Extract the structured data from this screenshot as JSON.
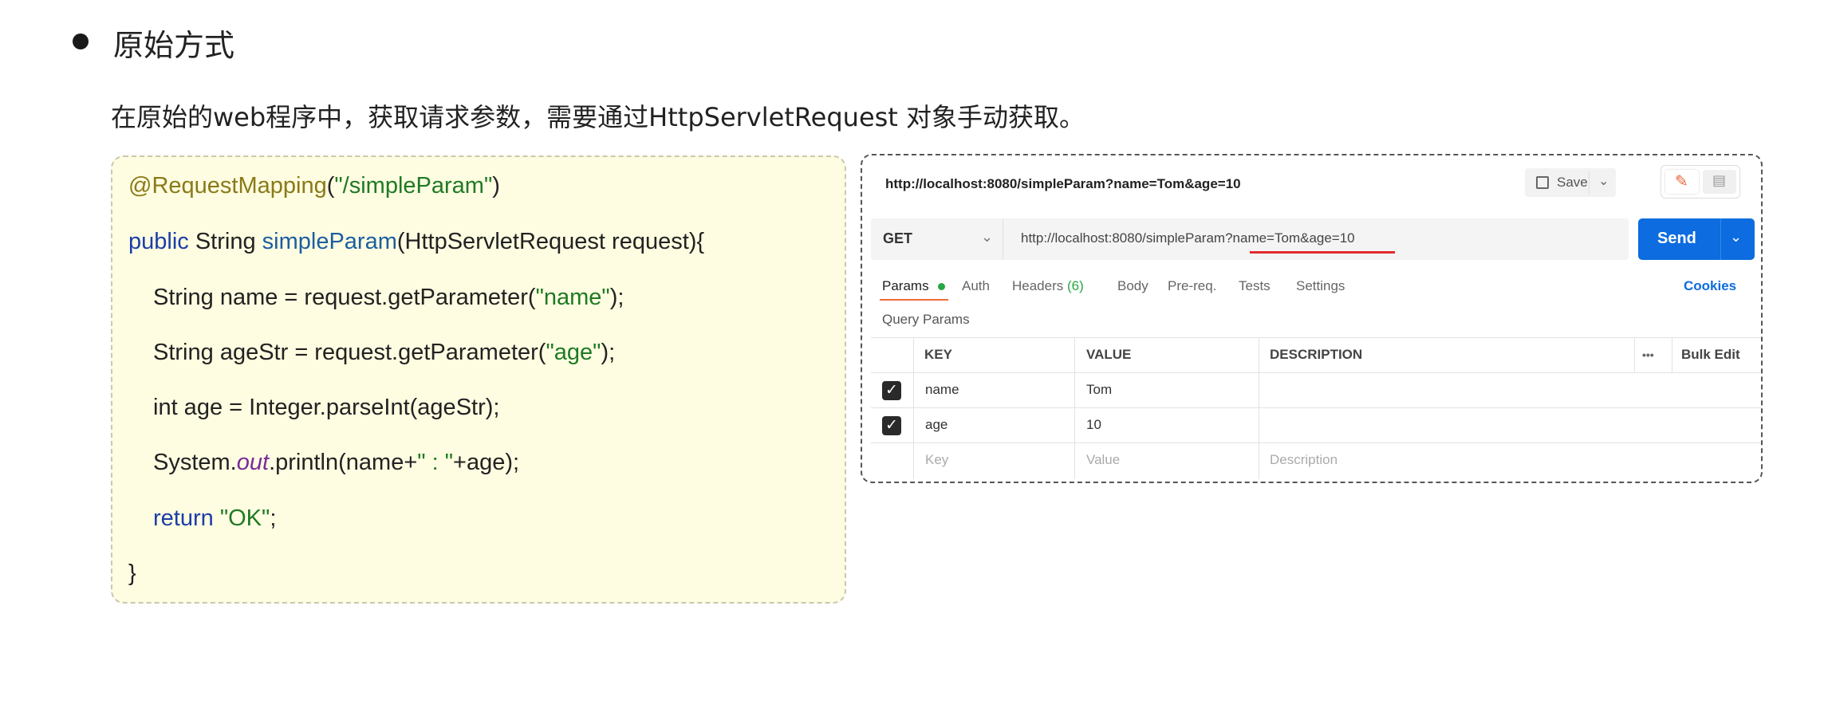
{
  "section": {
    "heading": "原始方式",
    "description": "在原始的web程序中，获取请求参数，需要通过HttpServletRequest 对象手动获取。"
  },
  "code": {
    "l1": {
      "annotation": "@RequestMapping",
      "open": "(",
      "path": "\"/simpleParam\"",
      "close": ")"
    },
    "l2": {
      "public": "public",
      "type": " String ",
      "method": "simpleParam",
      "params": "(HttpServletRequest request){"
    },
    "l3": {
      "a": "String name = request.getParameter(",
      "s": "\"name\"",
      "b": ");"
    },
    "l4": {
      "a": "String ageStr = request.getParameter(",
      "s": "\"age\"",
      "b": ");"
    },
    "l5": "int age = Integer.parseInt(ageStr);",
    "l6": {
      "a": "System.",
      "field": "out",
      "b": ".println(name+",
      "s": "\" : \"",
      "c": "+age);"
    },
    "l7": {
      "kw": "return",
      "s": " \"OK\"",
      "b": ";"
    },
    "l8": "}"
  },
  "postman": {
    "top_url": "http://localhost:8080/simpleParam?name=Tom&age=10",
    "save_label": "Save",
    "save_chevron": "⌄",
    "edit_icon_glyph": "✎",
    "comment_icon_glyph": "▤",
    "method": "GET",
    "method_chevron": "⌄",
    "url": "http://localhost:8080/simpleParam?name=Tom&age=10",
    "send_label": "Send",
    "send_chevron": "⌄",
    "tabs": {
      "params": "Params",
      "auth": "Auth",
      "headers": "Headers",
      "headers_count": "(6)",
      "body": "Body",
      "prereq": "Pre-req.",
      "tests": "Tests",
      "settings": "Settings"
    },
    "cookies": "Cookies",
    "query_params_title": "Query Params",
    "table": {
      "headers": {
        "key": "KEY",
        "value": "VALUE",
        "description": "DESCRIPTION",
        "more": "•••",
        "bulk_edit": "Bulk Edit"
      },
      "rows": [
        {
          "key": "name",
          "value": "Tom",
          "checked": true
        },
        {
          "key": "age",
          "value": "10",
          "checked": true
        }
      ],
      "placeholder": {
        "key": "Key",
        "value": "Value",
        "description": "Description"
      }
    },
    "check_glyph": "✓"
  },
  "colors": {
    "code_bg": "#fefce1",
    "keyword": "#1c3ea8",
    "annotation": "#8a7a18",
    "string": "#1f7a24",
    "send_button": "#0c6ce0",
    "url_underline": "#e12b2b",
    "active_tab_underline": "#f26b3a"
  }
}
